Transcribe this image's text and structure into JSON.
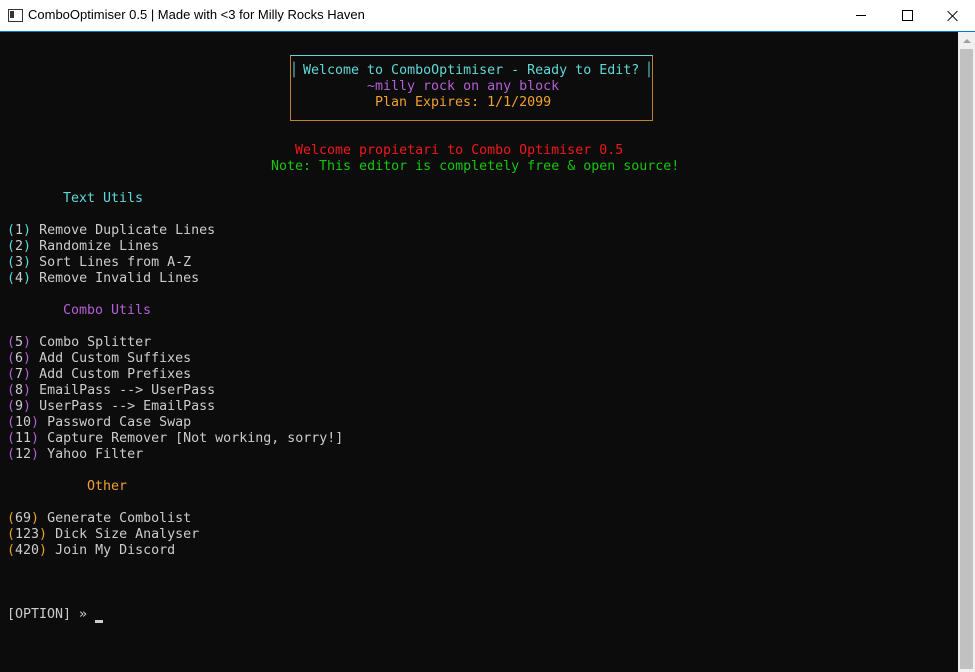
{
  "window": {
    "title": "ComboOptimiser 0.5 | Made with <3 for Milly Rocks Haven"
  },
  "banner": {
    "line1": "Welcome to ComboOptimiser - Ready to Edit?",
    "line2": "~milly rock on any block",
    "line3": "Plan Expires: 1/1/2099"
  },
  "welcome": {
    "greeting": "Welcome propietari to Combo Optimiser 0.5",
    "note": "Note: This editor is completely free & open source!"
  },
  "sections": {
    "text_utils": {
      "heading": "Text Utils",
      "items": [
        {
          "num": "1",
          "label": "Remove Duplicate Lines"
        },
        {
          "num": "2",
          "label": "Randomize Lines"
        },
        {
          "num": "3",
          "label": "Sort Lines from A-Z"
        },
        {
          "num": "4",
          "label": "Remove Invalid Lines"
        }
      ]
    },
    "combo_utils": {
      "heading": "Combo Utils",
      "items": [
        {
          "num": "5",
          "label": "Combo Splitter"
        },
        {
          "num": "6",
          "label": "Add Custom Suffixes"
        },
        {
          "num": "7",
          "label": "Add Custom Prefixes"
        },
        {
          "num": "8",
          "label": "EmailPass --> UserPass"
        },
        {
          "num": "9",
          "label": "UserPass --> EmailPass"
        },
        {
          "num": "10",
          "label": "Password Case Swap"
        },
        {
          "num": "11",
          "label": "Capture Remover [Not working, sorry!]"
        },
        {
          "num": "12",
          "label": "Yahoo Filter"
        }
      ]
    },
    "other": {
      "heading": "Other",
      "items": [
        {
          "num": "69",
          "label": "Generate Combolist"
        },
        {
          "num": "123",
          "label": "Dick Size Analyser"
        },
        {
          "num": "420",
          "label": "Join My Discord"
        }
      ]
    }
  },
  "prompt": {
    "text": "[OPTION] »"
  },
  "colors": {
    "background": "#0c0c0c",
    "cyan": "#61d6d6",
    "purple": "#b45fd6",
    "orange": "#f0a030",
    "red": "#f01818",
    "green": "#16c60c"
  }
}
